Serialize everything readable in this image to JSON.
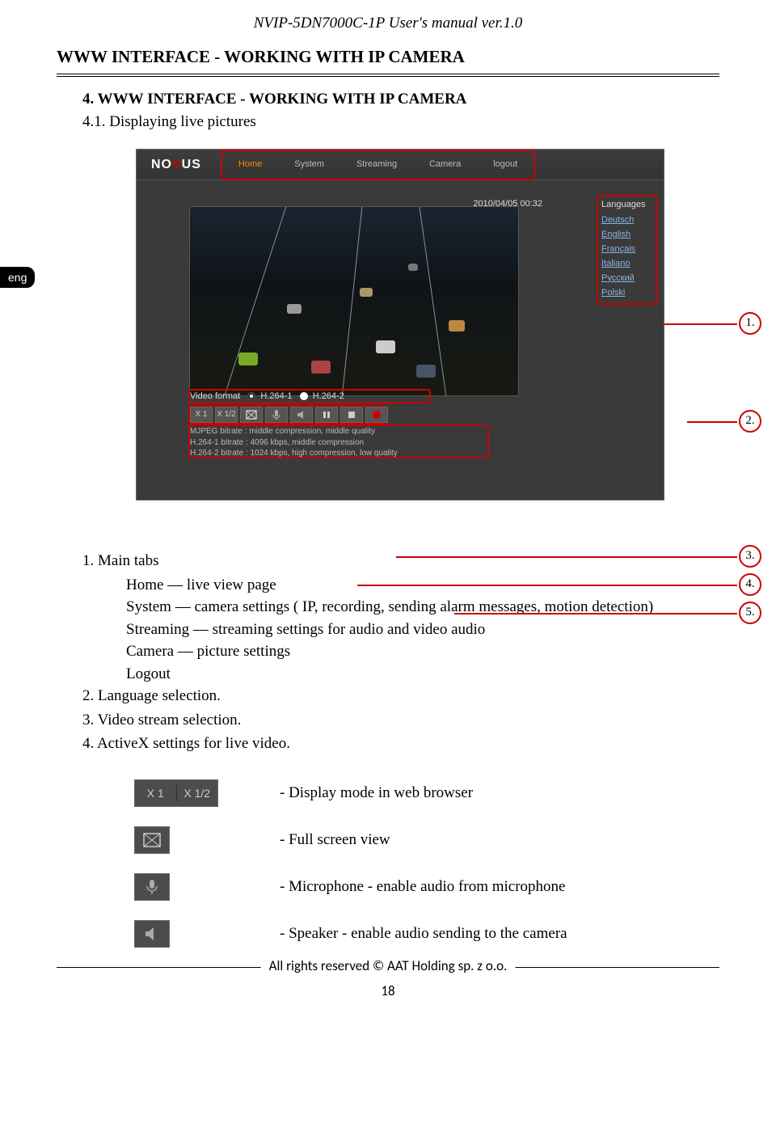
{
  "header": {
    "doc_title": "NVIP-5DN7000C-1P User's manual ver.1.0",
    "section_header": "WWW INTERFACE - WORKING WITH IP CAMERA",
    "chapter": "4. WWW INTERFACE - WORKING WITH IP CAMERA",
    "subchapter": "4.1. Displaying live pictures"
  },
  "lang_badge": "eng",
  "screenshot": {
    "logo": "NOVUS",
    "nav": [
      "Home",
      "System",
      "Streaming",
      "Camera",
      "logout"
    ],
    "nav_active_index": 0,
    "timestamp": "2010/04/05 00:32",
    "lang_header": "Languages",
    "languages": [
      "Deutsch",
      "English",
      "Français",
      "Italiano",
      "Русский",
      "Polski"
    ],
    "video_format_label": "Video format",
    "video_format_options": [
      "H.264-1",
      "H.264-2"
    ],
    "toolbar_text": [
      "X 1",
      "X 1/2"
    ],
    "bitrates": [
      "MJPEG bitrate : middle compression, middle quality",
      "H.264-1 bitrate : 4096 kbps, middle compression",
      "H.264-2 bitrate : 1024 kbps, high compression, low quality"
    ]
  },
  "callouts": {
    "c1": "1.",
    "c2": "2.",
    "c3": "3.",
    "c4": "4.",
    "c5": "5."
  },
  "list": {
    "item1": "1.  Main tabs",
    "item1_home": "Home — live view page",
    "item1_system": "System — camera settings  ( IP, recording, sending alarm messages, motion detection)",
    "item1_streaming": "Streaming —  streaming settings for audio and video audio",
    "item1_camera": "Camera — picture settings",
    "item1_logout": "Logout",
    "item2": "2.  Language selection.",
    "item3": "3.  Video stream selection.",
    "item4": "4.  ActiveX settings for live video."
  },
  "icons": {
    "x1": "X 1",
    "x12": "X 1/2",
    "display_mode": "- Display mode in web browser",
    "fullscreen": "- Full screen view",
    "microphone": "- Microphone - enable audio from microphone",
    "speaker": "- Speaker - enable audio sending to the camera"
  },
  "footer": {
    "copyright": "All rights reserved © AAT Holding sp. z o.o.",
    "page": "18"
  }
}
